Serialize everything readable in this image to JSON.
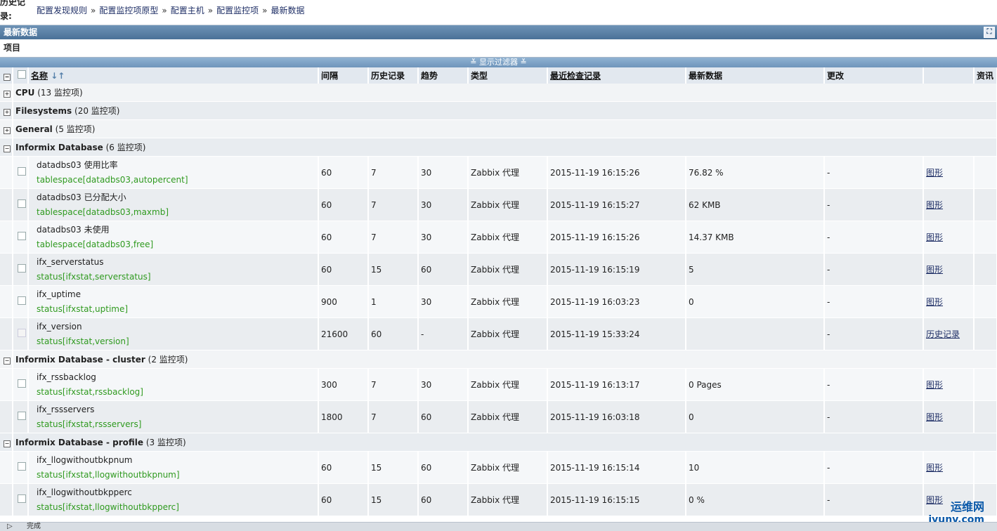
{
  "header": {
    "history_label": "历史记录:",
    "breadcrumbs": [
      "配置发现规则",
      "配置监控项原型",
      "配置主机",
      "配置监控项",
      "最新数据"
    ],
    "separator": "»"
  },
  "panel": {
    "title": "最新数据",
    "fullscreen_icon": "fullscreen-icon"
  },
  "section": {
    "title": "项目"
  },
  "filter": {
    "label": "≚ 显示过滤器 ≚"
  },
  "table": {
    "headers": {
      "name": "名称",
      "interval": "间隔",
      "history": "历史记录",
      "trends": "趋势",
      "type": "类型",
      "last_check": "最近检查记录",
      "last_value": "最新数据",
      "change": "更改",
      "actions": "",
      "info": "资讯"
    },
    "groups": [
      {
        "name": "CPU",
        "count": "(13 监控项)",
        "expanded": false,
        "items": []
      },
      {
        "name": "Filesystems",
        "count": "(20 监控项)",
        "expanded": false,
        "items": []
      },
      {
        "name": "General",
        "count": "(5 监控项)",
        "expanded": false,
        "items": []
      },
      {
        "name": "Informix Database",
        "count": "(6 监控项)",
        "expanded": true,
        "items": [
          {
            "name": "datadbs03 使用比率",
            "key": "tablespace[datadbs03,autopercent]",
            "interval": "60",
            "history": "7",
            "trends": "30",
            "type": "Zabbix 代理",
            "last_check": "2015-11-19 16:15:26",
            "last_value": "76.82 %",
            "change": "-",
            "action": "图形",
            "disabled": false
          },
          {
            "name": "datadbs03 已分配大小",
            "key": "tablespace[datadbs03,maxmb]",
            "interval": "60",
            "history": "7",
            "trends": "30",
            "type": "Zabbix 代理",
            "last_check": "2015-11-19 16:15:27",
            "last_value": "62 KMB",
            "change": "-",
            "action": "图形",
            "disabled": false
          },
          {
            "name": "datadbs03 未使用",
            "key": "tablespace[datadbs03,free]",
            "interval": "60",
            "history": "7",
            "trends": "30",
            "type": "Zabbix 代理",
            "last_check": "2015-11-19 16:15:26",
            "last_value": "14.37 KMB",
            "change": "-",
            "action": "图形",
            "disabled": false
          },
          {
            "name": "ifx_serverstatus",
            "key": "status[ifxstat,serverstatus]",
            "interval": "60",
            "history": "15",
            "trends": "60",
            "type": "Zabbix 代理",
            "last_check": "2015-11-19 16:15:19",
            "last_value": "5",
            "change": "-",
            "action": "图形",
            "disabled": false
          },
          {
            "name": "ifx_uptime",
            "key": "status[ifxstat,uptime]",
            "interval": "900",
            "history": "1",
            "trends": "30",
            "type": "Zabbix 代理",
            "last_check": "2015-11-19 16:03:23",
            "last_value": "0",
            "change": "-",
            "action": "图形",
            "disabled": false
          },
          {
            "name": "ifx_version",
            "key": "status[ifxstat,version]",
            "interval": "21600",
            "history": "60",
            "trends": "-",
            "type": "Zabbix 代理",
            "last_check": "2015-11-19 15:33:24",
            "last_value": "",
            "change": "-",
            "action": "历史记录",
            "disabled": true
          }
        ]
      },
      {
        "name": "Informix Database - cluster",
        "count": "(2 监控项)",
        "expanded": true,
        "items": [
          {
            "name": "ifx_rssbacklog",
            "key": "status[ifxstat,rssbacklog]",
            "interval": "300",
            "history": "7",
            "trends": "30",
            "type": "Zabbix 代理",
            "last_check": "2015-11-19 16:13:17",
            "last_value": "0 Pages",
            "change": "-",
            "action": "图形",
            "disabled": false
          },
          {
            "name": "ifx_rssservers",
            "key": "status[ifxstat,rssservers]",
            "interval": "1800",
            "history": "7",
            "trends": "60",
            "type": "Zabbix 代理",
            "last_check": "2015-11-19 16:03:18",
            "last_value": "0",
            "change": "-",
            "action": "图形",
            "disabled": false
          }
        ]
      },
      {
        "name": "Informix Database - profile",
        "count": "(3 监控项)",
        "expanded": true,
        "items": [
          {
            "name": "ifx_llogwithoutbkpnum",
            "key": "status[ifxstat,llogwithoutbkpnum]",
            "interval": "60",
            "history": "15",
            "trends": "60",
            "type": "Zabbix 代理",
            "last_check": "2015-11-19 16:15:14",
            "last_value": "10",
            "change": "-",
            "action": "图形",
            "disabled": false
          },
          {
            "name": "ifx_llogwithoutbkpperc",
            "key": "status[ifxstat,llogwithoutbkpperc]",
            "interval": "60",
            "history": "15",
            "trends": "60",
            "type": "Zabbix 代理",
            "last_check": "2015-11-19 16:15:15",
            "last_value": "0 %",
            "change": "-",
            "action": "图形",
            "disabled": false
          }
        ]
      }
    ]
  },
  "statusbar": {
    "text": "完成"
  },
  "watermark": {
    "cn": "运维网",
    "en": "iyunv.com"
  }
}
